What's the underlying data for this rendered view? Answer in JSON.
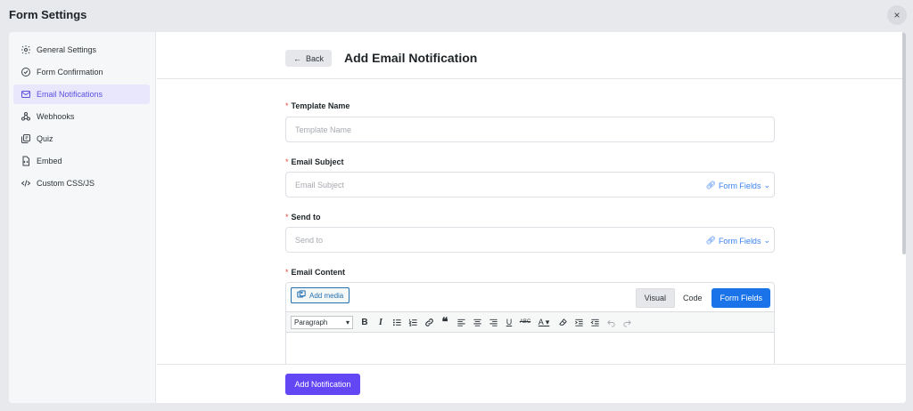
{
  "window": {
    "title": "Form Settings",
    "close_symbol": "×"
  },
  "sidebar": {
    "items": [
      {
        "label": "General Settings",
        "icon": "gear-icon",
        "active": false
      },
      {
        "label": "Form Confirmation",
        "icon": "check-circle-icon",
        "active": false
      },
      {
        "label": "Email Notifications",
        "icon": "mail-icon",
        "active": true
      },
      {
        "label": "Webhooks",
        "icon": "webhook-icon",
        "active": false
      },
      {
        "label": "Quiz",
        "icon": "quiz-icon",
        "active": false
      },
      {
        "label": "Embed",
        "icon": "embed-file-icon",
        "active": false
      },
      {
        "label": "Custom CSS/JS",
        "icon": "code-icon",
        "active": false
      }
    ],
    "active_color": "#5b4fe0",
    "active_bg": "#e8e7fb"
  },
  "header": {
    "back_label": "Back",
    "title": "Add Email Notification"
  },
  "form": {
    "required_marker": "*",
    "template_name": {
      "label": "Template Name",
      "placeholder": "Template Name",
      "value": ""
    },
    "email_subject": {
      "label": "Email Subject",
      "placeholder": "Email Subject",
      "value": "",
      "fields_link": "Form Fields"
    },
    "send_to": {
      "label": "Send to",
      "placeholder": "Send to",
      "value": "",
      "fields_link": "Form Fields"
    },
    "email_content": {
      "label": "Email Content",
      "add_media_label": "Add media",
      "tabs": {
        "visual": "Visual",
        "code": "Code",
        "form_fields": "Form Fields"
      },
      "format_select": "Paragraph",
      "toolbar_icons": [
        "bold-icon",
        "italic-icon",
        "bullet-list-icon",
        "numbered-list-icon",
        "link-icon",
        "blockquote-icon",
        "align-left-icon",
        "align-center-icon",
        "align-right-icon",
        "underline-icon",
        "strikethrough-icon",
        "text-color-icon",
        "clear-format-icon",
        "indent-icon",
        "outdent-icon",
        "undo-icon",
        "redo-icon"
      ]
    }
  },
  "footer": {
    "submit_label": "Add Notification"
  },
  "colors": {
    "primary": "#6347f5",
    "link": "#3c82f6",
    "tab_blue": "#1a73e8",
    "required": "#e0483b"
  }
}
